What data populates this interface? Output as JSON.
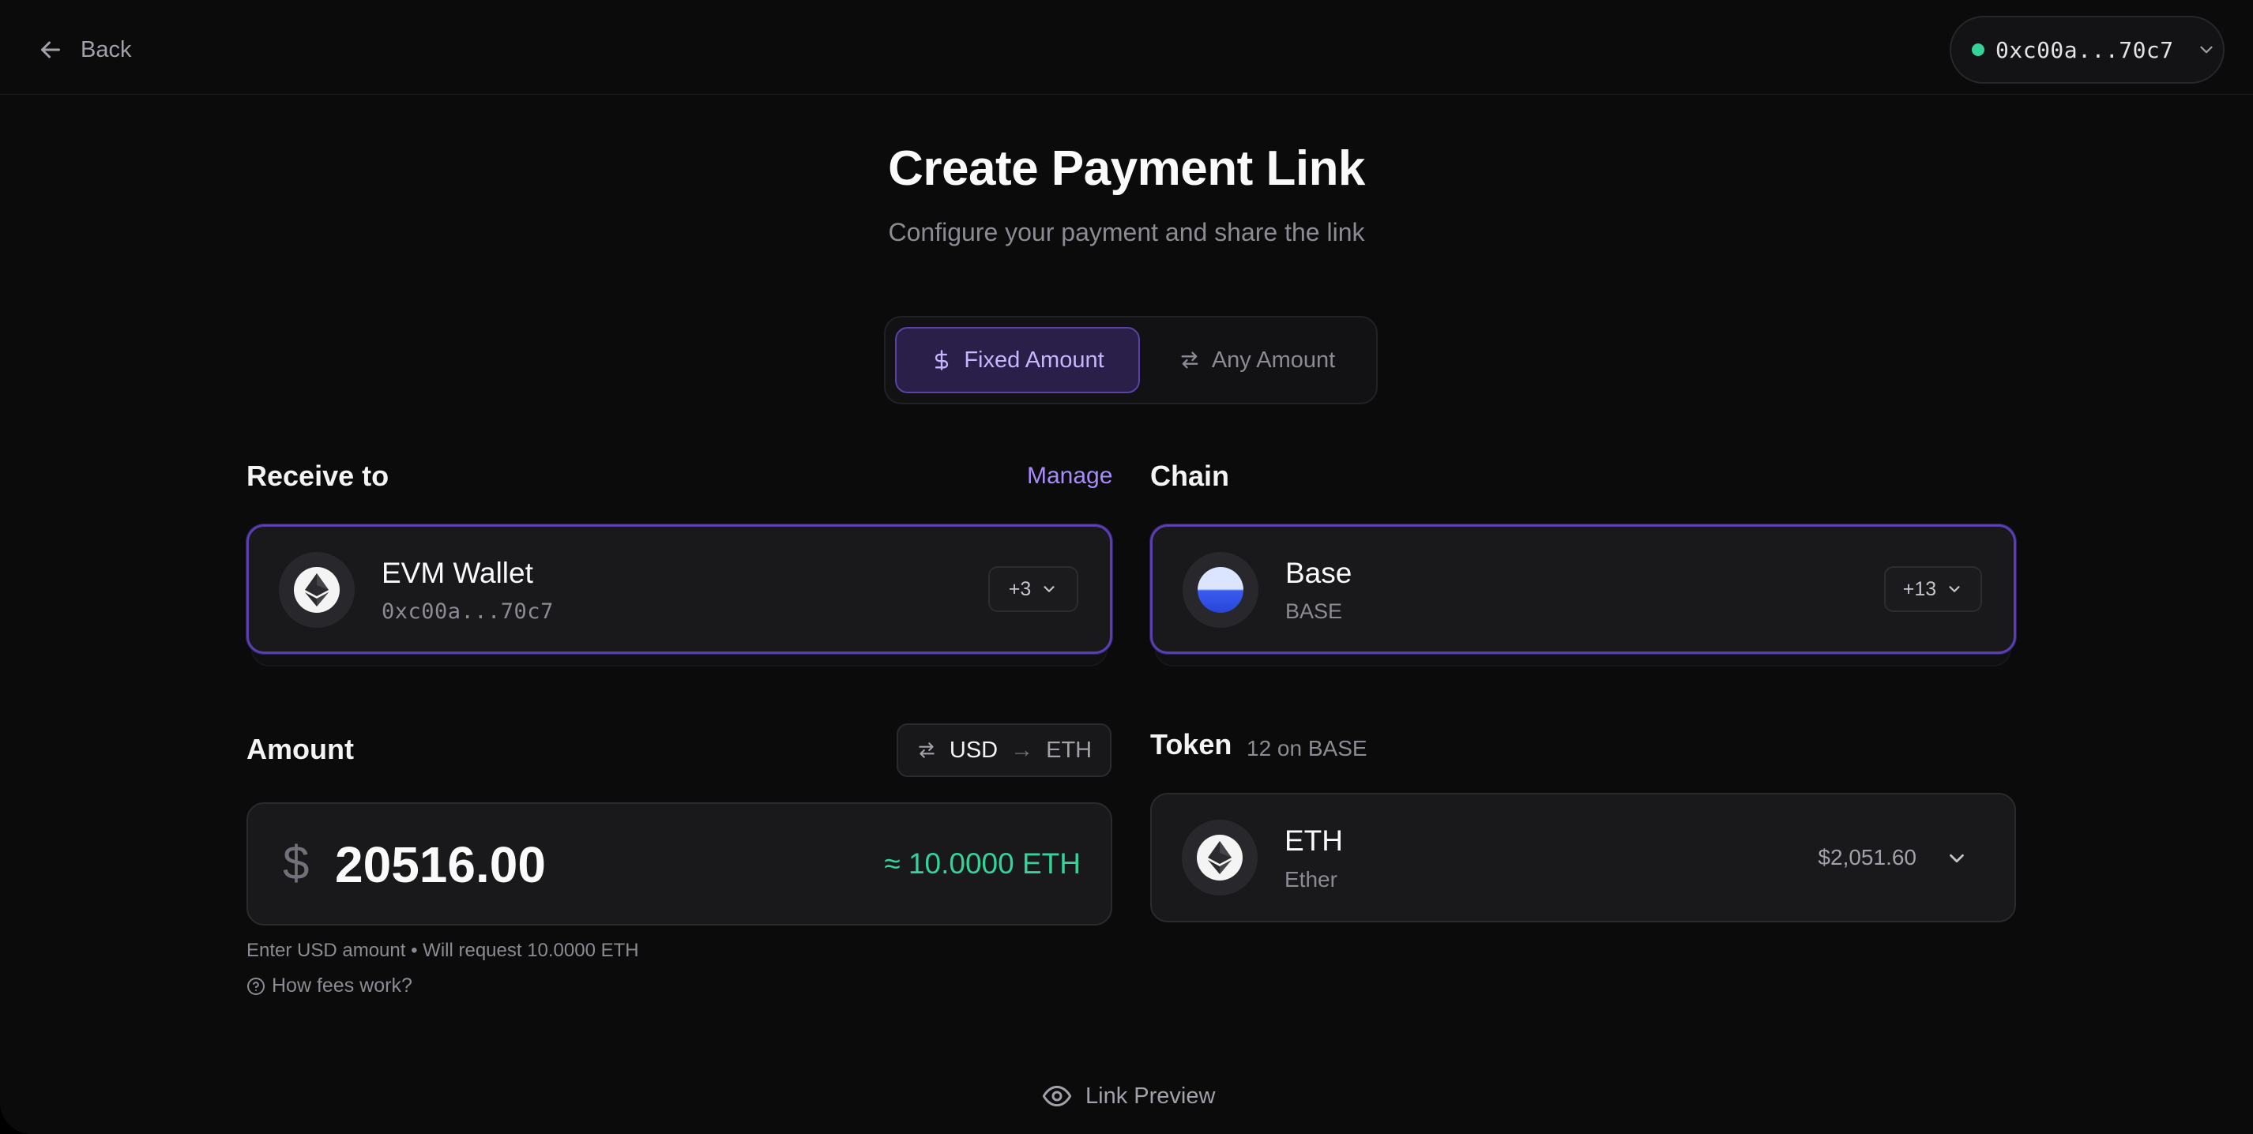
{
  "nav": {
    "back_label": "Back"
  },
  "wallet": {
    "address": "0xc00a...70c7",
    "status_color": "#34d399"
  },
  "header": {
    "title": "Create Payment Link",
    "subtitle": "Configure your payment and share the link"
  },
  "mode": {
    "selected": "fixed",
    "fixed_label": "Fixed Amount",
    "any_label": "Any Amount"
  },
  "receive": {
    "label": "Receive to",
    "manage_label": "Manage",
    "wallet_name": "EVM Wallet",
    "wallet_address": "0xc00a...70c7",
    "more": "+3",
    "icon": "ethereum-icon"
  },
  "chain": {
    "label": "Chain",
    "name": "Base",
    "code": "BASE",
    "more": "+13",
    "icon": "base-chain-icon"
  },
  "amount": {
    "label": "Amount",
    "currency_from": "USD",
    "currency_arrow": "→",
    "currency_to": "ETH",
    "currency_symbol": "$",
    "value": "20516.00",
    "approx": "≈ 10.0000 ETH",
    "helper": "Enter USD amount • Will request 10.0000 ETH",
    "fees_link": "How fees work?"
  },
  "token": {
    "label": "Token",
    "count": "12 on BASE",
    "symbol": "ETH",
    "name": "Ether",
    "price": "$2,051.60",
    "icon": "ethereum-icon"
  },
  "footer": {
    "preview_label": "Link Preview"
  },
  "colors": {
    "accent": "#a78bfa",
    "accent_border": "#5b3fb0",
    "success": "#34d399",
    "background": "#0b0b0c"
  }
}
